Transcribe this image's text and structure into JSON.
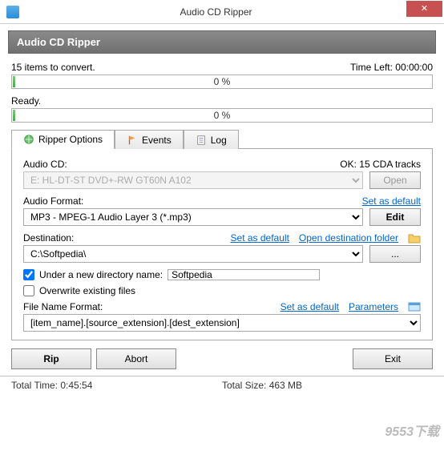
{
  "window": {
    "title": "Audio CD Ripper"
  },
  "banner": "Audio CD Ripper",
  "status": {
    "items_text": "15 items to convert.",
    "time_left_label": "Time Left: 00:00:00",
    "progress_total": "0 %",
    "ready": "Ready.",
    "progress_item": "0 %"
  },
  "tabs": {
    "ripper": "Ripper Options",
    "events": "Events",
    "log": "Log"
  },
  "ripper": {
    "audio_cd_label": "Audio CD:",
    "audio_cd_status": "OK: 15 CDA tracks",
    "audio_cd_value": "E: HL-DT-ST DVD+-RW GT60N    A102",
    "open_btn": "Open",
    "format_label": "Audio Format:",
    "format_default": "Set as default",
    "format_value": "MP3 - MPEG-1 Audio Layer 3 (*.mp3)",
    "edit_btn": "Edit",
    "dest_label": "Destination:",
    "dest_default": "Set as default",
    "dest_open": "Open destination folder",
    "dest_value": "C:\\Softpedia\\",
    "browse_btn": "...",
    "newdir_label": "Under a new directory name:",
    "newdir_value": "Softpedia",
    "overwrite_label": "Overwrite existing files",
    "filename_label": "File Name Format:",
    "filename_default": "Set as default",
    "filename_params": "Parameters",
    "filename_value": "[item_name].[source_extension].[dest_extension]"
  },
  "buttons": {
    "rip": "Rip",
    "abort": "Abort",
    "exit": "Exit"
  },
  "footer": {
    "total_time": "Total Time:  0:45:54",
    "total_size": "Total Size:  463 MB"
  },
  "watermark": "9553下载"
}
